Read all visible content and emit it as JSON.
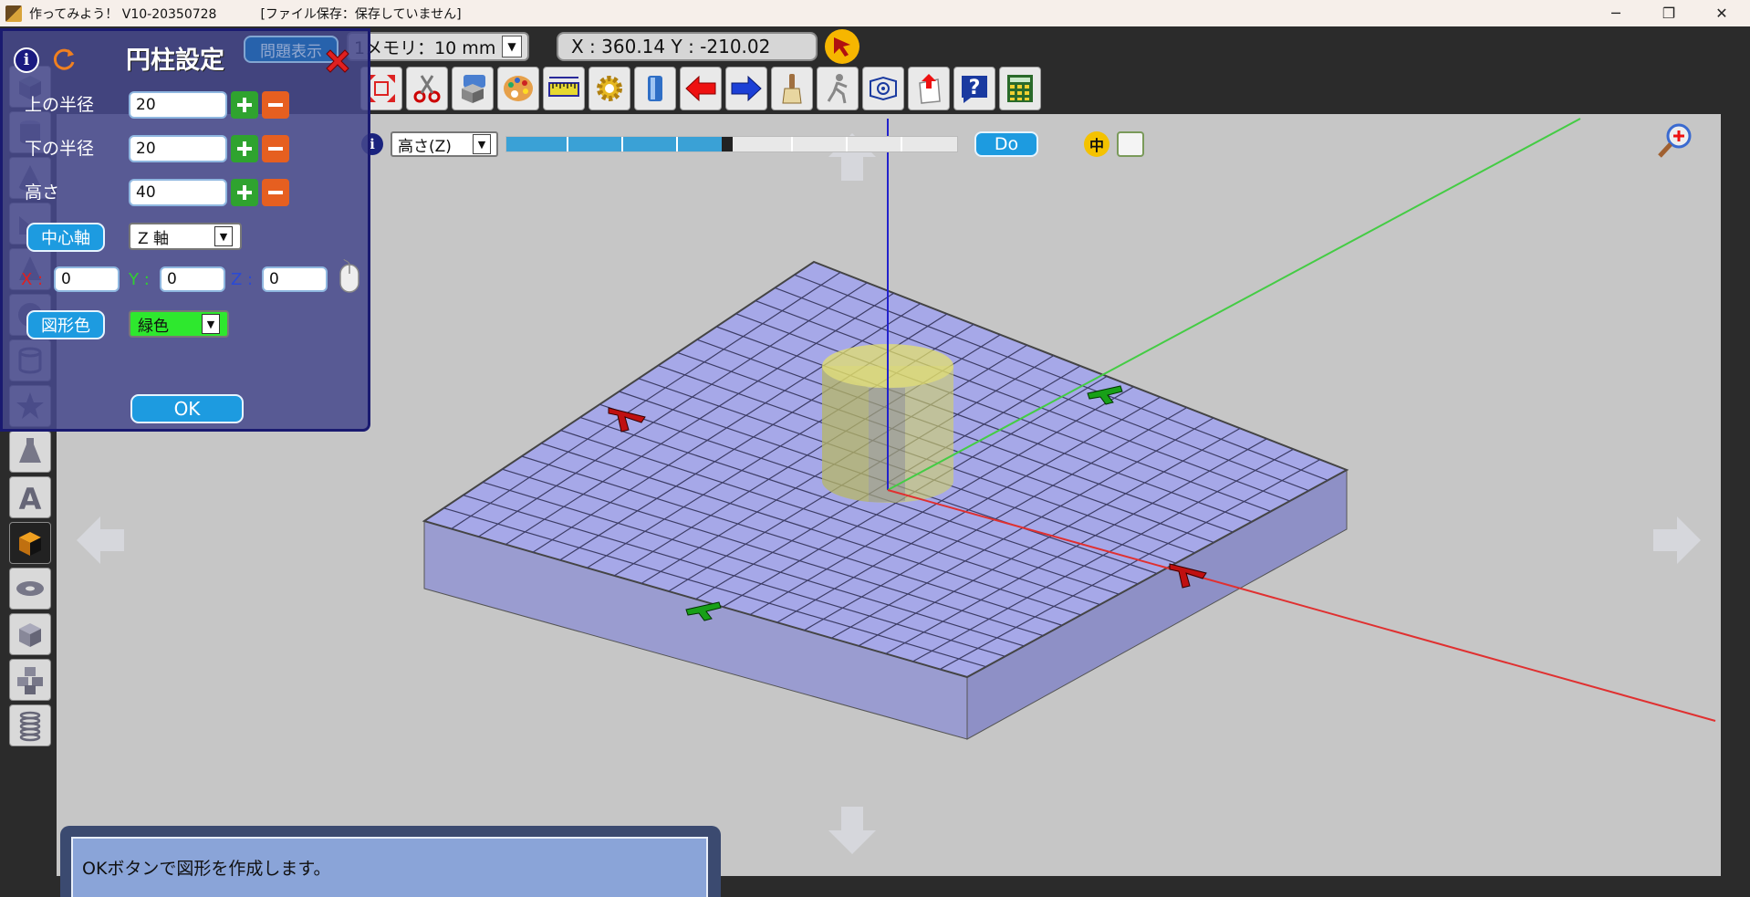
{
  "window": {
    "title": "作ってみよう！ V10-20350728",
    "file_status": "[ファイル保存：保存していません]",
    "minimize": "─",
    "maximize": "❐",
    "close": "✕"
  },
  "toolbar": {
    "memory_value": "1メモリ：10 mm",
    "coord_readout": "X : 360.14  Y : -210.02",
    "tools": [
      "fit-view-icon",
      "scissors-icon",
      "box-comment-icon",
      "palette-icon",
      "ruler-icon",
      "gear-icon",
      "bucket-icon",
      "undo-arrow-icon",
      "redo-arrow-icon",
      "brush-icon",
      "walker-icon",
      "camera-icon",
      "export-icon",
      "help-icon",
      "calculator-icon"
    ]
  },
  "height_controls": {
    "info": "i",
    "axis_value": "高さ(Z)",
    "slider_percent": 49,
    "do_label": "Do",
    "mid_label": "中"
  },
  "dialog": {
    "title": "円柱設定",
    "info": "i",
    "problem_label": "問題表示",
    "top_radius_label": "上の半径",
    "top_radius_value": "20",
    "bottom_radius_label": "下の半径",
    "bottom_radius_value": "20",
    "height_label": "高さ",
    "height_value": "40",
    "center_axis_label": "中心軸",
    "center_axis_value": "Z 軸",
    "x_label": "X :",
    "y_label": "Y :",
    "z_label": "Z :",
    "x_value": "0",
    "y_value": "0",
    "z_value": "0",
    "color_label": "図形色",
    "color_value": "緑色",
    "ok_label": "OK"
  },
  "status": {
    "message": "OKボタンで図形を作成します。"
  },
  "colors": {
    "accent": "#1d9be0",
    "grid_fill": "#a6a8e8",
    "cylinder": "#e6e36a",
    "axis_x": "#e33",
    "axis_y": "#4c4",
    "axis_z": "#22c"
  }
}
